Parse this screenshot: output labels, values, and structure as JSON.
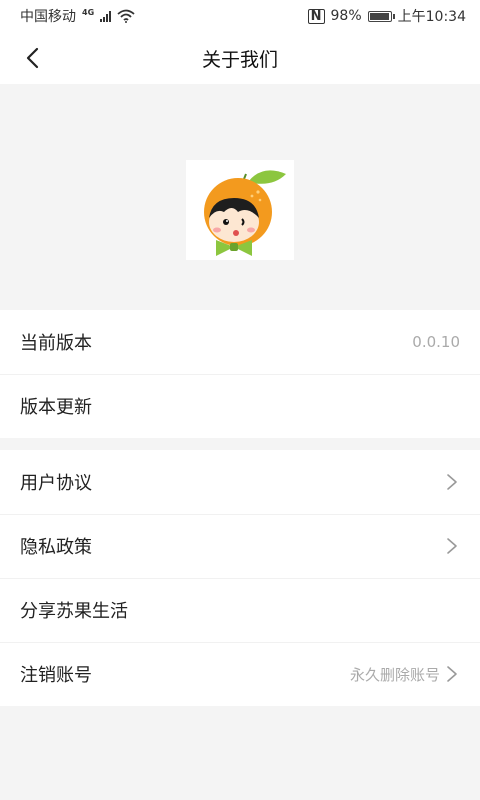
{
  "status_bar": {
    "carrier": "中国移动",
    "network": "4G",
    "nfc": "N",
    "battery": "98%",
    "battery_level_pct": 98,
    "time": "上午10:34"
  },
  "header": {
    "title": "关于我们",
    "back_icon": "chevron-left-icon"
  },
  "logo": {
    "icon": "orange-mascot-logo"
  },
  "groups": [
    {
      "rows": [
        {
          "label": "当前版本",
          "value": "0.0.10",
          "chevron": false
        },
        {
          "label": "版本更新",
          "value": "",
          "chevron": false
        }
      ]
    },
    {
      "rows": [
        {
          "label": "用户协议",
          "value": "",
          "chevron": true
        },
        {
          "label": "隐私政策",
          "value": "",
          "chevron": true
        },
        {
          "label": "分享苏果生活",
          "value": "",
          "chevron": false
        },
        {
          "label": "注销账号",
          "value": "永久删除账号",
          "chevron": true
        }
      ]
    }
  ],
  "colors": {
    "page_background": "#f4f4f4",
    "card_background": "#ffffff",
    "logo_orange": "#f39a1e",
    "logo_leaf": "#8cc63f",
    "muted_text": "#aaaaaa"
  }
}
